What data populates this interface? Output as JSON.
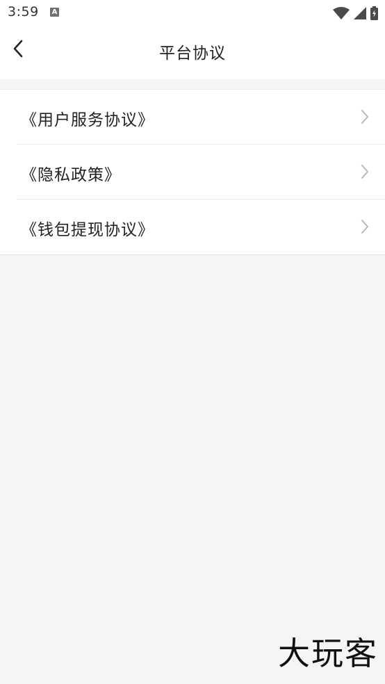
{
  "status_bar": {
    "time": "3:59",
    "notification_icon": "a-icon",
    "icons": [
      "wifi-icon",
      "signal-icon",
      "battery-icon"
    ]
  },
  "header": {
    "title": "平台协议",
    "back_icon": "chevron-left-icon"
  },
  "items": [
    {
      "label": "《用户服务协议》"
    },
    {
      "label": "《隐私政策》"
    },
    {
      "label": "《钱包提现协议》"
    }
  ],
  "watermark": "大玩客",
  "colors": {
    "background": "#f5f5f7",
    "surface": "#ffffff",
    "divider": "#ececef",
    "text": "#222222",
    "chevron": "#b8b8bc"
  }
}
